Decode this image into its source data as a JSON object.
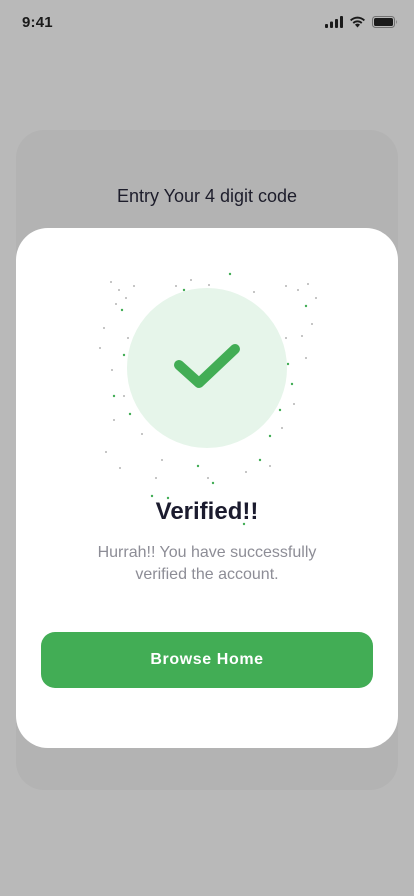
{
  "status_bar": {
    "time": "9:41",
    "icons": [
      "signal-icon",
      "wifi-icon",
      "battery-icon"
    ]
  },
  "background_screen": {
    "title": "Entry Your 4 digit code"
  },
  "modal": {
    "icon": "checkmark-icon",
    "title": "Verified!!",
    "message": "Hurrah!!  You have successfully verified the account.",
    "button_label": "Browse Home"
  },
  "colors": {
    "accent": "#42AD55",
    "accent_light": "#E6F5EA",
    "overlay": "#B9B9B9",
    "title_text": "#1B1B2E",
    "body_text": "#8D8D96"
  }
}
